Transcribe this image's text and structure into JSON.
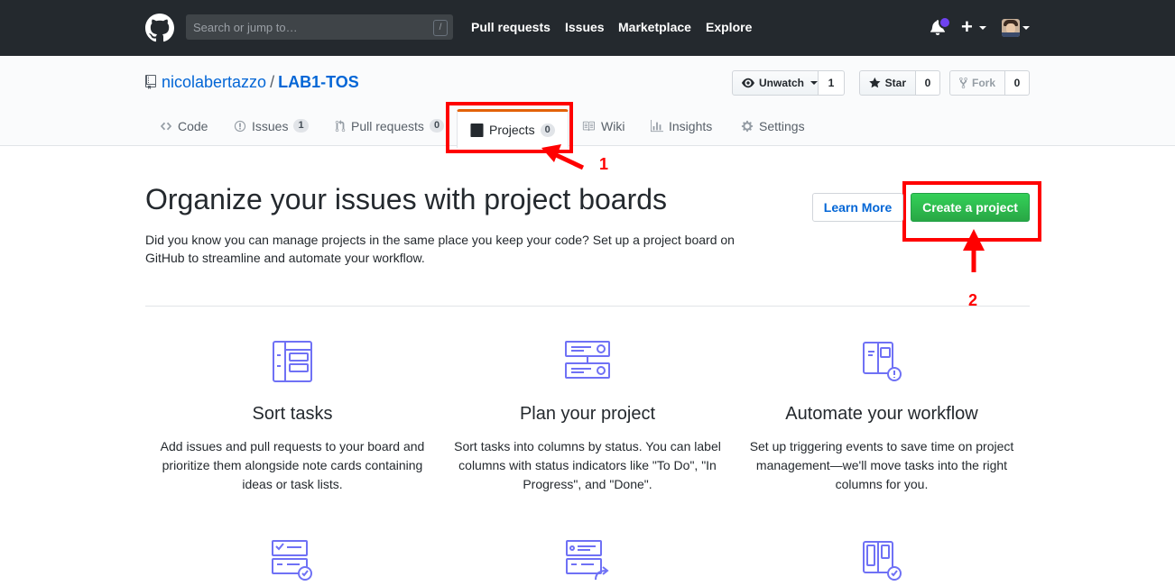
{
  "header": {
    "search_placeholder": "Search or jump to…",
    "search_shortcut": "/",
    "nav": [
      "Pull requests",
      "Issues",
      "Marketplace",
      "Explore"
    ],
    "plus_label": "+"
  },
  "repo": {
    "owner": "nicolabertazzo",
    "separator": "/",
    "name": "LAB1-TOS",
    "watch_label": "Unwatch",
    "watch_count": "1",
    "star_label": "Star",
    "star_count": "0",
    "fork_label": "Fork",
    "fork_count": "0"
  },
  "tabs": {
    "code": "Code",
    "issues": "Issues",
    "issues_count": "1",
    "pulls": "Pull requests",
    "pulls_count": "0",
    "projects": "Projects",
    "projects_count": "0",
    "wiki": "Wiki",
    "insights": "Insights",
    "settings": "Settings"
  },
  "annotations": {
    "one": "1",
    "two": "2",
    "color": "#ff0000"
  },
  "hero": {
    "title": "Organize your issues with project boards",
    "description": "Did you know you can manage projects in the same place you keep your code? Set up a project board on GitHub to streamline and automate your workflow.",
    "learn_more": "Learn More",
    "create": "Create a project"
  },
  "features": [
    {
      "icon": "sort-tasks-icon",
      "title": "Sort tasks",
      "text": "Add issues and pull requests to your board and prioritize them alongside note cards containing ideas or task lists."
    },
    {
      "icon": "plan-project-icon",
      "title": "Plan your project",
      "text": "Sort tasks into columns by status. You can label columns with status indicators like \"To Do\", \"In Progress\", and \"Done\"."
    },
    {
      "icon": "automate-workflow-icon",
      "title": "Automate your workflow",
      "text": "Set up triggering events to save time on project management—we'll move tasks into the right columns for you."
    }
  ],
  "colors": {
    "topbar": "#24292e",
    "accent": "#0366d6",
    "create_green": "#28a745",
    "illustration": "#6f71f5"
  }
}
